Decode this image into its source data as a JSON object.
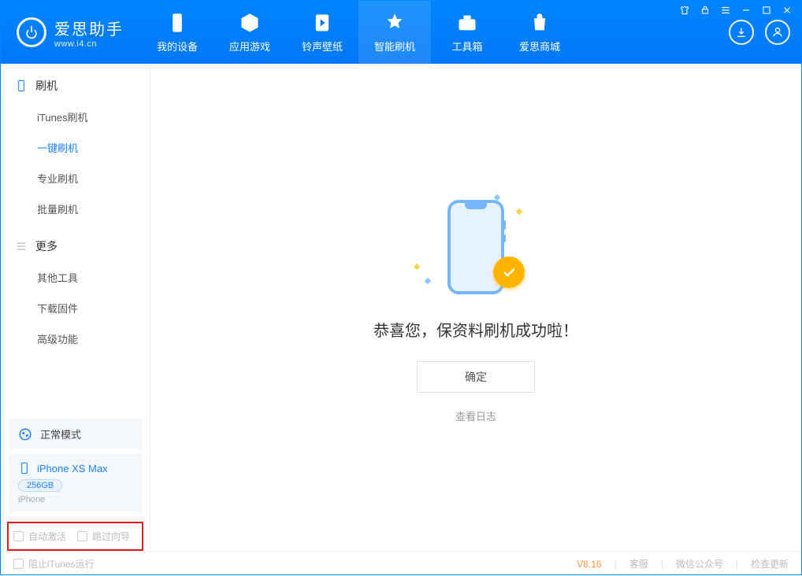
{
  "brand": {
    "name_cn": "爱思助手",
    "url": "www.i4.cn"
  },
  "tabs": {
    "device": "我的设备",
    "apps": "应用游戏",
    "ring": "铃声壁纸",
    "flash": "智能刷机",
    "toolbox": "工具箱",
    "store": "爱思商城"
  },
  "sidebar": {
    "group_flash": "刷机",
    "items_flash": {
      "itunes": "iTunes刷机",
      "oneclick": "一键刷机",
      "pro": "专业刷机",
      "batch": "批量刷机"
    },
    "group_more": "更多",
    "items_more": {
      "other": "其他工具",
      "firmware": "下载固件",
      "advanced": "高级功能"
    },
    "mode_label": "正常模式",
    "device": {
      "name": "iPhone XS Max",
      "storage": "256GB",
      "type": "iPhone"
    },
    "opt_auto_activate": "自动激活",
    "opt_skip_guide": "跳过向导"
  },
  "main": {
    "success_title": "恭喜您，保资料刷机成功啦！",
    "ok": "确定",
    "view_log": "查看日志"
  },
  "footer": {
    "stop_itunes": "阻止iTunes运行",
    "version": "V8.16",
    "cs": "客服",
    "wechat": "微信公众号",
    "update": "检查更新"
  }
}
